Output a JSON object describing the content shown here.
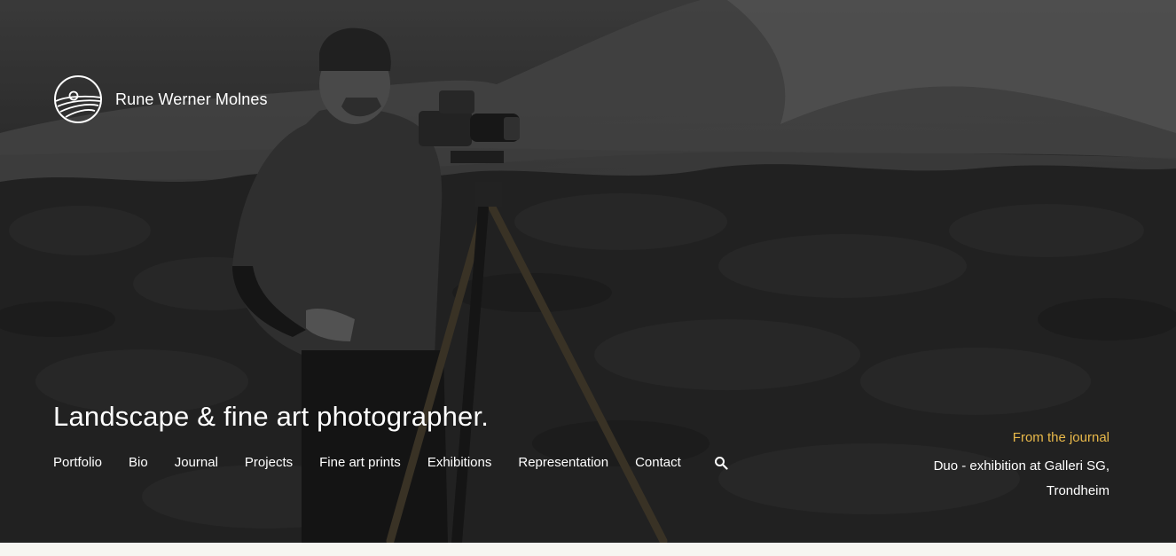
{
  "brand": {
    "logo_icon": "sun-over-waves-logo",
    "name": "Rune Werner Molnes"
  },
  "hero": {
    "tagline": "Landscape & fine art photographer."
  },
  "nav": {
    "items": [
      "Portfolio",
      "Bio",
      "Journal",
      "Projects",
      "Fine art prints",
      "Exhibitions",
      "Representation",
      "Contact"
    ],
    "search_icon": "search-icon"
  },
  "journal": {
    "label": "From the journal",
    "link_line1": "Duo - exhibition at Galleri SG,",
    "link_line2": "Trondheim"
  },
  "colors": {
    "accent": "#e9b94a",
    "text": "#ffffff",
    "footer_background": "#f6f5f1"
  }
}
